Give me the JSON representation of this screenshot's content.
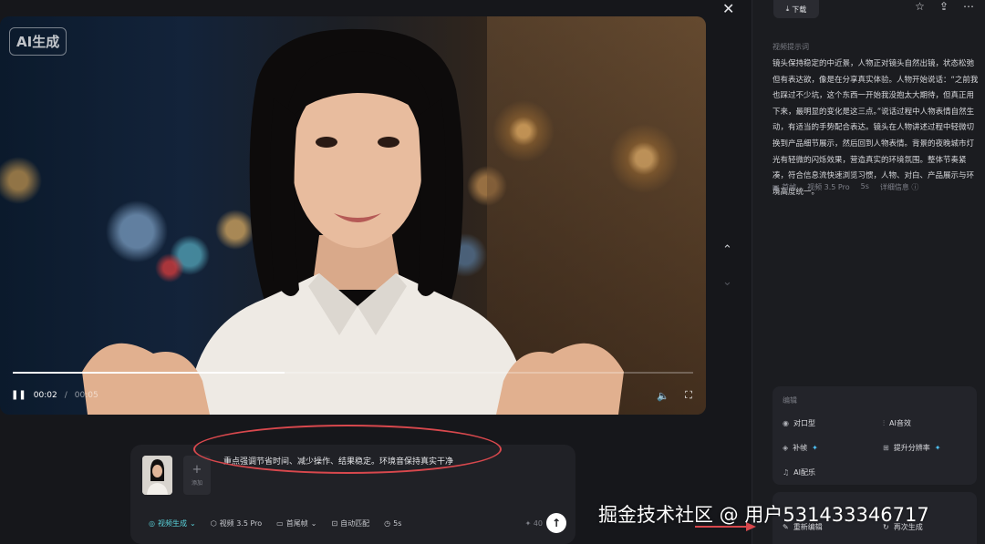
{
  "video": {
    "badge": "AI生成",
    "current_time": "00:02",
    "separator": "/",
    "duration": "00:05",
    "progress": 0.4
  },
  "prompt": {
    "text": "重点强调节省时间、减少操作、结果稳定。环境音保持真实干净",
    "add_label": "添加",
    "tools": [
      "视频生成",
      "视频 3.5 Pro",
      "首尾帧",
      "自动匹配",
      "5s"
    ],
    "credits": "40"
  },
  "sidebar": {
    "download_label": "下载",
    "section_label": "视频提示词",
    "description": "镜头保持稳定的中近景，人物正对镜头自然出镜，状态松弛但有表达欲，像是在分享真实体验。人物开始说话：“之前我也踩过不少坑，这个东西一开始我没抱太大期待，但真正用下来，最明显的变化是这三点。”说话过程中人物表情自然生动，有适当的手势配合表达。镜头在人物讲述过程中轻微切换到产品细节展示，然后回到人物表情。背景的夜晚城市灯光有轻微的闪烁效果，营造真实的环境氛围。整体节奏紧凑，符合信息流快速浏览习惯，人物、对白、产品展示与环境高度统一。",
    "meta": [
      "首帧",
      "视频 3.5 Pro",
      "5s",
      "详细信息"
    ],
    "edit_title": "编辑",
    "edit_options": [
      "对口型",
      "AI音效",
      "补帧",
      "提升分辨率",
      "AI配乐"
    ],
    "bottom_options": [
      "重新编辑",
      "再次生成"
    ]
  },
  "watermark": "掘金技术社区 @ 用户531433346717",
  "colors": {
    "accent": "#59d1d9",
    "spark": "#4fc3f7",
    "annotation": "#d8484d"
  }
}
